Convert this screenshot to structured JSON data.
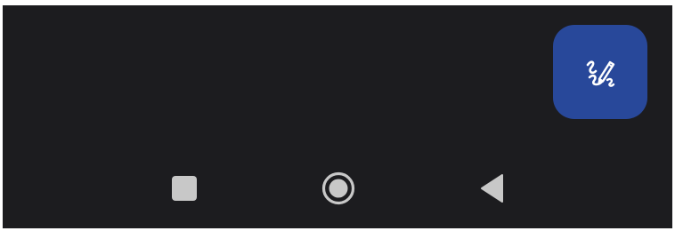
{
  "fab": {
    "icon": "handwriting-pen-icon",
    "background_color": "#28489a",
    "icon_color": "#ffffff"
  },
  "navigation_bar": {
    "background_color": "#1c1c1f",
    "icon_color": "#c8c8c8",
    "buttons": [
      {
        "icon": "recents-square-icon"
      },
      {
        "icon": "home-circle-icon"
      },
      {
        "icon": "back-triangle-icon"
      }
    ]
  }
}
